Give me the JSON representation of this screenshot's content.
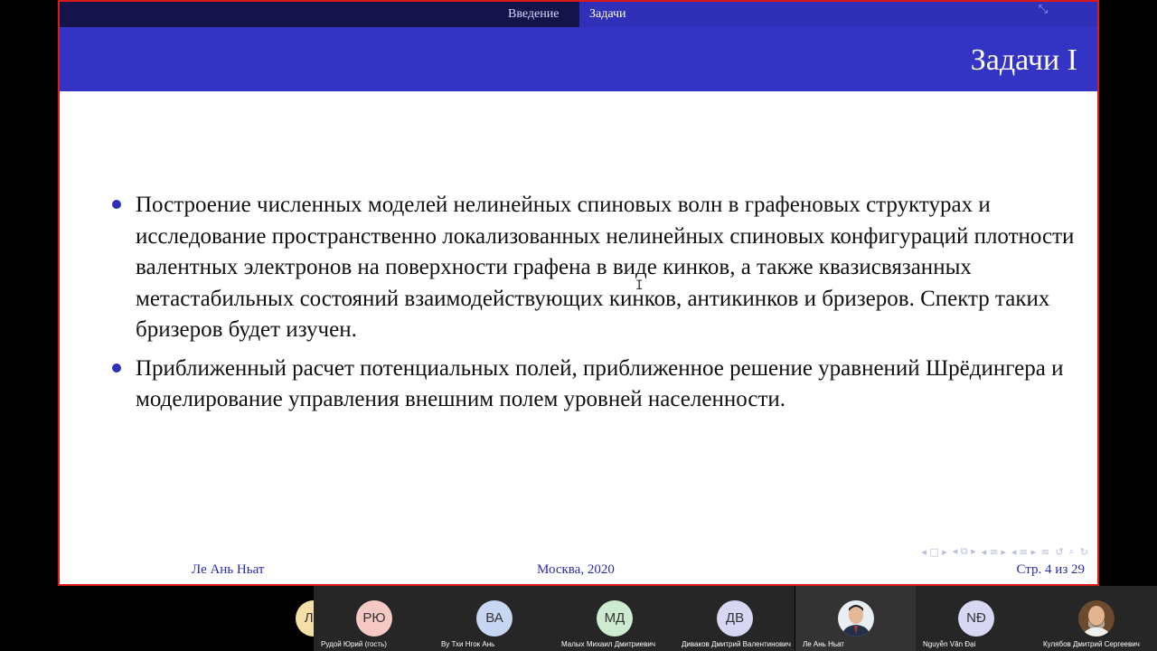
{
  "nav": {
    "sections": [
      "Введение",
      "Задачи"
    ],
    "active_section": "Задачи",
    "exit_fullscreen_icon": "compress-arrows-icon"
  },
  "slide": {
    "title": "Задачи I",
    "bullets": [
      "Построение численных моделей нелинейных спиновых волн в графеновых структурах и исследование пространственно локализованных нелинейных спиновых конфигураций плотности валентных электронов на поверхности графена в виде кинков, а также квазисвязанных метастабильных состояний взаимодействующих кинков, антикинков и бризеров. Спектр таких бризеров будет изучен.",
      "Приближенный расчет потенциальных полей, приближенное решение уравнений Шрёдингера и моделирование управления внешним полем уровней населенности."
    ]
  },
  "footer": {
    "author": "Ле Ань Ньат",
    "location": "Москва, 2020",
    "page": "Стр. 4 из 29"
  },
  "beamer_nav": {
    "icons": [
      "first-icon",
      "frame-icon",
      "next-icon",
      "subsection-icon",
      "section-icon",
      "search-icon",
      "undo-icon",
      "zoom-icon"
    ]
  },
  "colors": {
    "nav_dark": "#14144a",
    "accent": "#3434c4",
    "footer_text": "#2c2ca8",
    "frame_border": "#d81b1b"
  },
  "participants": [
    {
      "initials": "ЛП",
      "name": "",
      "color": "#f4dfa8"
    },
    {
      "initials": "РЮ",
      "name": "Рудой Юрий (гость)",
      "color": "#f7c9c5"
    },
    {
      "initials": "ВА",
      "name": "Ву Тхи Нгок Ань",
      "color": "#c7d6f2"
    },
    {
      "initials": "МД",
      "name": "Малых Михаил Дмитриевич",
      "color": "#cdebd0"
    },
    {
      "initials": "ДВ",
      "name": "Диваков Дмитрий Валентинович",
      "color": "#d8d7f3"
    },
    {
      "initials": "",
      "name": "Ле Ань Ньат",
      "color": "photo"
    },
    {
      "initials": "NĐ",
      "name": "Nguyễn Văn Đại",
      "color": "#d8d7f3"
    },
    {
      "initials": "",
      "name": "Кулябов Дмитрий Сергеевич",
      "color": "photo"
    }
  ]
}
